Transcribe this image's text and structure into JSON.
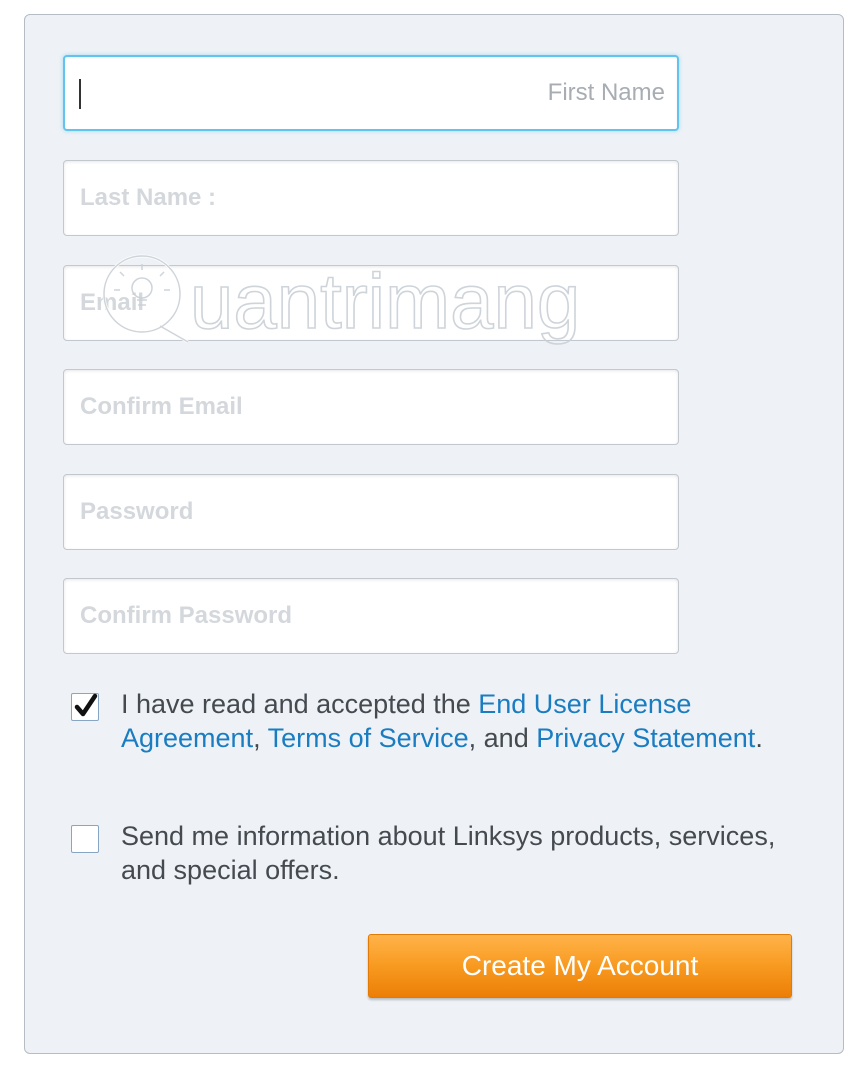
{
  "form": {
    "fields": [
      {
        "name": "first-name-field",
        "placeholder": "First Name",
        "value": "",
        "focused": true
      },
      {
        "name": "last-name-field",
        "placeholder": "Last Name :",
        "value": ""
      },
      {
        "name": "email-field",
        "placeholder": "Email",
        "value": ""
      },
      {
        "name": "confirm-email-field",
        "placeholder": "Confirm Email",
        "value": ""
      },
      {
        "name": "password-field",
        "placeholder": "Password",
        "value": ""
      },
      {
        "name": "confirm-password-field",
        "placeholder": "Confirm Password",
        "value": ""
      }
    ],
    "agreement": {
      "checked": true,
      "text_before": "I have read and accepted the ",
      "eula_link": "End User License Agreement",
      "sep1": ", ",
      "tos_link": "Terms of Service",
      "sep2": ", and ",
      "privacy_link": "Privacy Statement",
      "text_after": "."
    },
    "newsletter": {
      "checked": false,
      "text": "Send me information about Linksys products, services, and special offers."
    },
    "submit_label": "Create My Account"
  },
  "watermark": {
    "text": "uantrimang"
  },
  "colors": {
    "accent": "#1a7cc1",
    "button": "#f89a20",
    "focus_border": "#61c3ee",
    "panel_bg": "#eef2f6"
  }
}
